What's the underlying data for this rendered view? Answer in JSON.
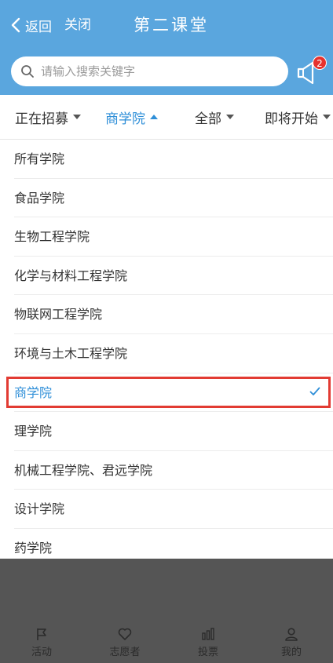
{
  "header": {
    "back_label": "返回",
    "close_label": "关闭",
    "title": "第二课堂",
    "bg_color": "#5aa6de"
  },
  "search": {
    "placeholder": "请输入搜索关键字",
    "value": "",
    "icon": "search-icon"
  },
  "notice": {
    "icon": "megaphone-icon",
    "badge_count": "2"
  },
  "filters": [
    {
      "label": "正在招募",
      "state": "collapsed"
    },
    {
      "label": "商学院",
      "state": "expanded"
    },
    {
      "label": "全部",
      "state": "collapsed"
    },
    {
      "label": "即将开始",
      "state": "collapsed"
    }
  ],
  "colleges": [
    {
      "label": "所有学院"
    },
    {
      "label": "食品学院"
    },
    {
      "label": "生物工程学院"
    },
    {
      "label": "化学与材料工程学院"
    },
    {
      "label": "物联网工程学院"
    },
    {
      "label": "环境与土木工程学院"
    },
    {
      "label": "商学院",
      "selected": true
    },
    {
      "label": "理学院"
    },
    {
      "label": "机械工程学院、君远学院"
    },
    {
      "label": "设计学院"
    },
    {
      "label": "药学院"
    }
  ],
  "tabbar": [
    {
      "label": "活动",
      "icon": "flag-icon"
    },
    {
      "label": "志愿者",
      "icon": "heart-icon"
    },
    {
      "label": "投票",
      "icon": "bar-chart-icon"
    },
    {
      "label": "我的",
      "icon": "user-icon"
    }
  ],
  "colors": {
    "accent": "#2f8fd8",
    "highlight_border": "#e23b33",
    "overlay": "#555555",
    "badge": "#e6322e"
  }
}
